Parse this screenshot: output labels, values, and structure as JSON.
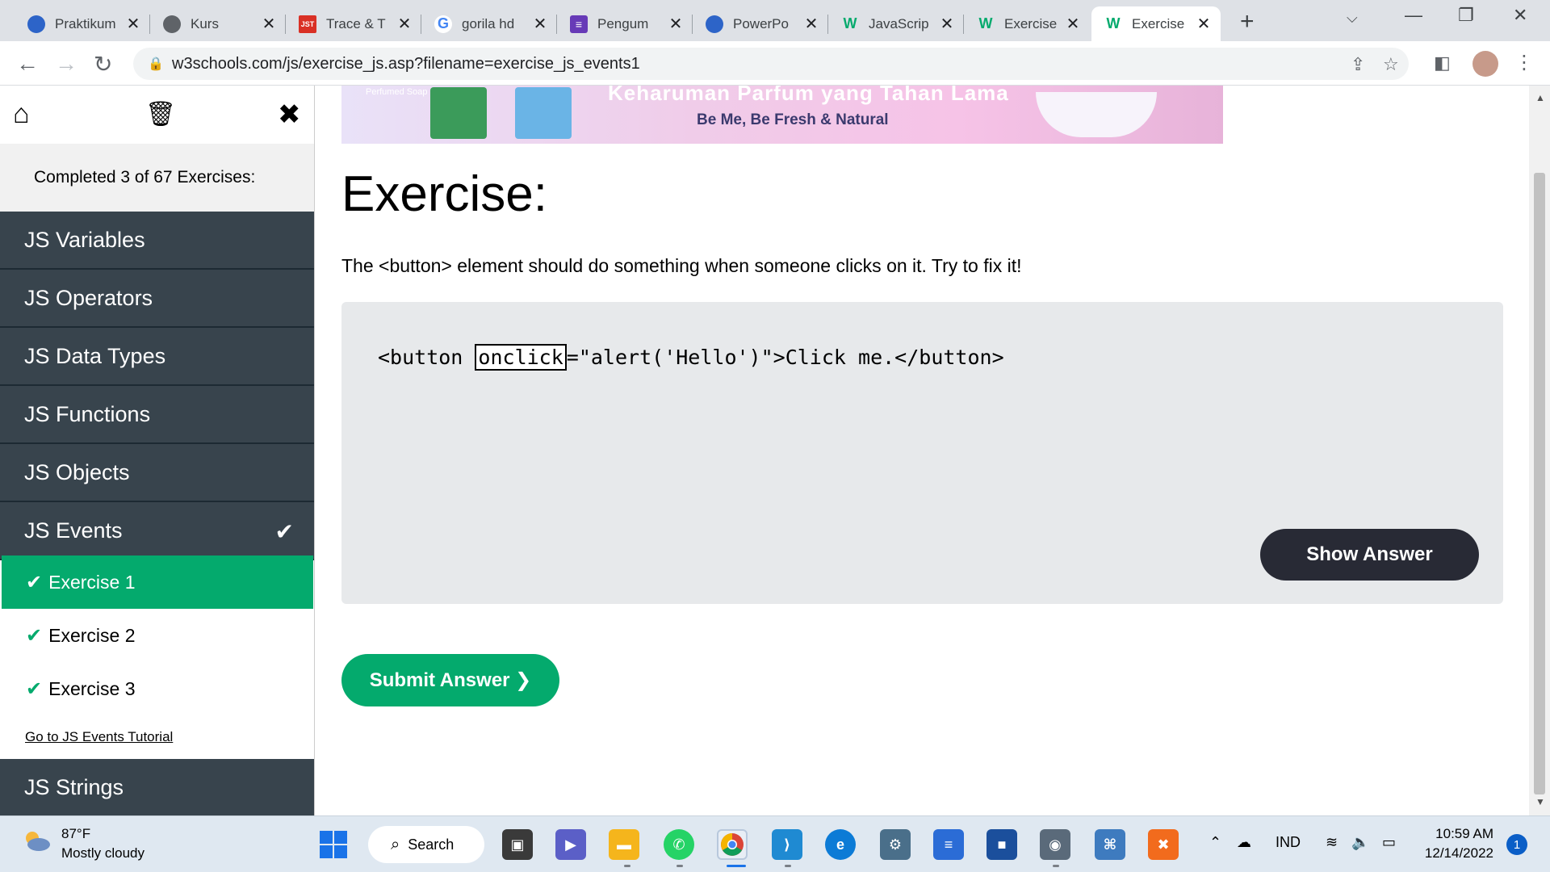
{
  "browser": {
    "tabs": [
      {
        "title": "Praktikum",
        "favicon": "globe-blue-icon",
        "color": "#2d64c8"
      },
      {
        "title": "Kurs",
        "favicon": "globe-gray-icon",
        "color": "#5f6368"
      },
      {
        "title": "Trace & T",
        "favicon": "jst-icon",
        "color": "#d93025"
      },
      {
        "title": "gorila hd",
        "favicon": "google-icon",
        "color": "#4285f4"
      },
      {
        "title": "Pengum",
        "favicon": "forms-icon",
        "color": "#673ab7"
      },
      {
        "title": "PowerPo",
        "favicon": "globe-blue-icon",
        "color": "#2d64c8"
      },
      {
        "title": "JavaScrip",
        "favicon": "w3schools-icon",
        "color": "#04aa6d"
      },
      {
        "title": "Exercise",
        "favicon": "w3schools-icon",
        "color": "#04aa6d"
      },
      {
        "title": "Exercise",
        "favicon": "w3schools-icon",
        "color": "#04aa6d"
      }
    ],
    "active_tab": 8,
    "url": "w3schools.com/js/exercise_js.asp?filename=exercise_js_events1"
  },
  "sidebar": {
    "completed": "Completed 3 of 67 Exercises:",
    "topics": [
      {
        "label": "JS Variables"
      },
      {
        "label": "JS Operators"
      },
      {
        "label": "JS Data Types"
      },
      {
        "label": "JS Functions"
      },
      {
        "label": "JS Objects"
      },
      {
        "label": "JS Events"
      }
    ],
    "exercises": [
      {
        "label": "Exercise 1"
      },
      {
        "label": "Exercise 2"
      },
      {
        "label": "Exercise 3"
      }
    ],
    "tutorial_link": "Go to JS Events Tutorial",
    "next_topic": "JS Strings"
  },
  "banner": {
    "brand": "Perfumed Soap",
    "headline": "Keharuman Parfum yang Tahan Lama",
    "tagline": "Be Me, Be Fresh & Natural"
  },
  "main": {
    "title": "Exercise:",
    "description": "The <button> element should do something when someone clicks on it. Try to fix it!",
    "code_before": "<button ",
    "answer_value": "onclick",
    "code_after": "=\"alert('Hello')\">Click me.</button>",
    "show_answer": "Show Answer",
    "submit": "Submit Answer ❯"
  },
  "taskbar": {
    "temperature": "87°F",
    "weather": "Mostly cloudy",
    "search": "Search",
    "language": "IND",
    "time": "10:59 AM",
    "date": "12/14/2022",
    "notifications": "1"
  },
  "colors": {
    "accent": "#04aa6d",
    "sidebar_dark": "#38444d",
    "show_answer_bg": "#282a35"
  }
}
